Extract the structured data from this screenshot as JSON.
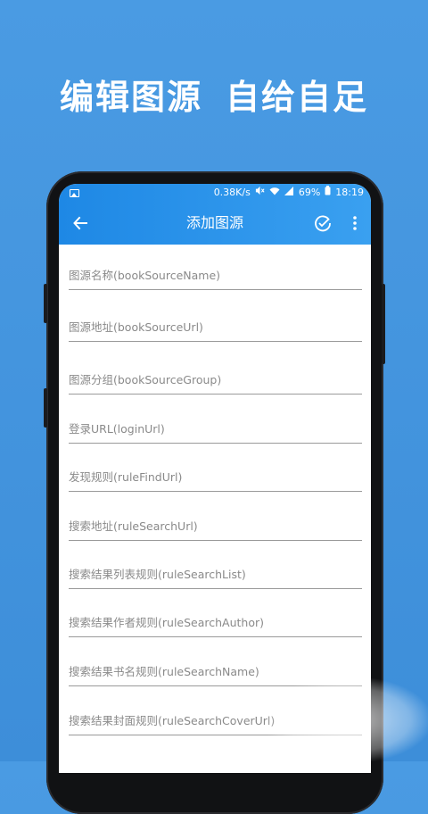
{
  "promo": {
    "title_left": "编辑图源",
    "title_right": "自给自足"
  },
  "status_bar": {
    "speed": "0.38K/s",
    "battery": "69%",
    "time": "18:19"
  },
  "app_bar": {
    "title": "添加图源",
    "back_icon": "arrow-left-icon",
    "confirm_icon": "check-circle-icon",
    "menu_icon": "more-vert-icon"
  },
  "fields": [
    {
      "label": "图源名称(bookSourceName)"
    },
    {
      "label": "图源地址(bookSourceUrl)"
    },
    {
      "label": "图源分组(bookSourceGroup)"
    },
    {
      "label": "登录URL(loginUrl)"
    },
    {
      "label": "发现规则(ruleFindUrl)"
    },
    {
      "label": "搜索地址(ruleSearchUrl)"
    },
    {
      "label": "搜索结果列表规则(ruleSearchList)"
    },
    {
      "label": "搜索结果作者规则(ruleSearchAuthor)"
    },
    {
      "label": "搜索结果书名规则(ruleSearchName)"
    },
    {
      "label": "搜索结果封面规则(ruleSearchCoverUrl)"
    }
  ],
  "colors": {
    "background": "#4a9be3",
    "app_bar": "#1e88e5",
    "underline": "#9a9a9a",
    "hint_text": "#8a8a8a"
  }
}
